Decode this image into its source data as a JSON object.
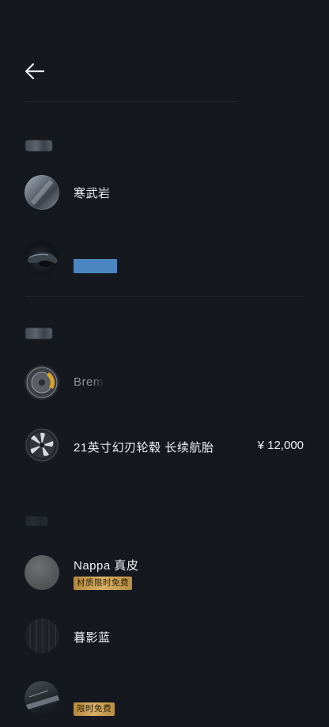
{
  "header": {
    "back_icon": "arrow-left-icon"
  },
  "sections": {
    "exterior_color": {
      "items": [
        {
          "label": "寒武岩",
          "thumb": "gray-paint-swatch"
        },
        {
          "label": "",
          "thumb": "car-detail-photo"
        }
      ]
    },
    "wheels": {
      "items": [
        {
          "label": "Brem",
          "thumb": "brembo-caliper-wheel"
        },
        {
          "label": "21英寸幻刃轮毂 长续航胎",
          "price": "¥ 12,000",
          "thumb": "bladed-wheel"
        }
      ]
    },
    "interior": {
      "items": [
        {
          "label": "Nappa 真皮",
          "badge": "材质限时免费",
          "thumb": "gray-leather-swatch"
        },
        {
          "label": "暮影蓝",
          "thumb": "dark-seat-swatch"
        },
        {
          "label": "",
          "badge": "限时免费",
          "thumb": "car-interior-photo"
        }
      ]
    }
  },
  "colors": {
    "background": "#15181f",
    "text": "#eef0f3",
    "badge_gold": "#d7b067",
    "blue_tag": "#4b86c0"
  }
}
